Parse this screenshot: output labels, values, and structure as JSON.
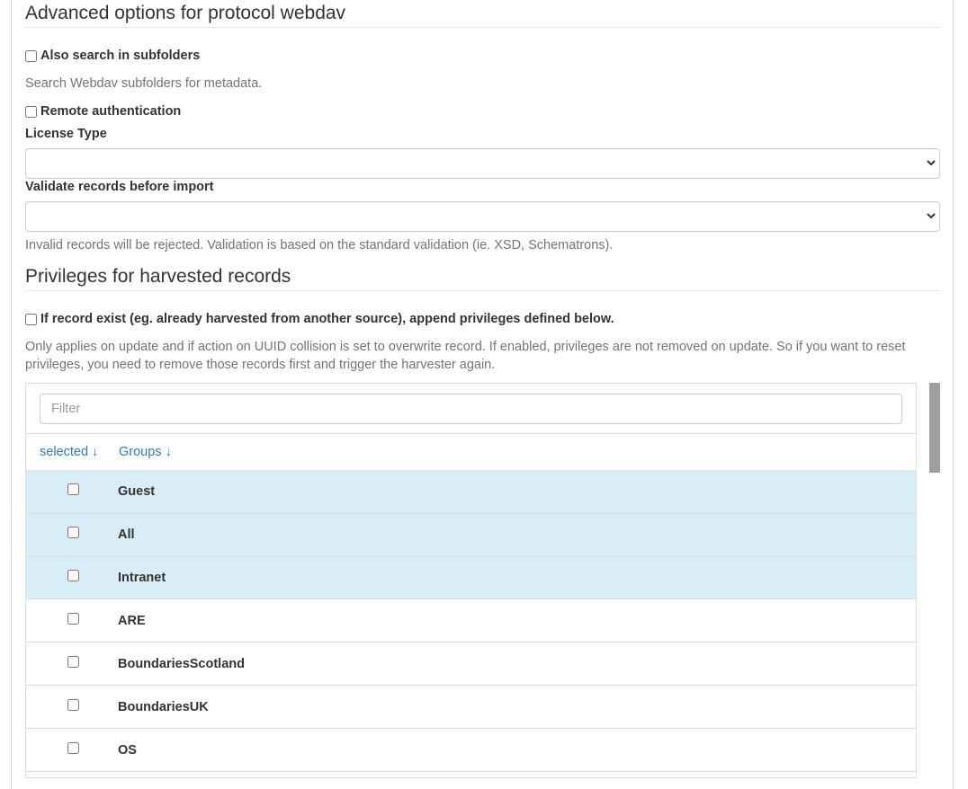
{
  "advanced": {
    "title": "Advanced options for protocol webdav",
    "subfolders_label": "Also search in subfolders",
    "subfolders_help": "Search Webdav subfolders for metadata.",
    "remote_auth_label": "Remote authentication",
    "license_label": "License Type",
    "license_value": "",
    "validate_label": "Validate records before import",
    "validate_value": "",
    "validate_help": "Invalid records will be rejected. Validation is based on the standard validation (ie. XSD, Schematrons)."
  },
  "privileges": {
    "title": "Privileges for harvested records",
    "append_label": "If record exist (eg. already harvested from another source), append privileges defined below.",
    "append_help": "Only applies on update and if action on UUID collision is set to overwrite record. If enabled, privileges are not removed on update. So if you want to reset privileges, you need to remove those records first and trigger the harvester again.",
    "filter_placeholder": "Filter",
    "col_selected": "selected ↓",
    "col_groups": "Groups ↓",
    "rows": [
      {
        "name": "Guest",
        "highlighted": true,
        "checked": false
      },
      {
        "name": "All",
        "highlighted": true,
        "checked": false
      },
      {
        "name": "Intranet",
        "highlighted": true,
        "checked": false
      },
      {
        "name": "ARE",
        "highlighted": false,
        "checked": false
      },
      {
        "name": "BoundariesScotland",
        "highlighted": false,
        "checked": false
      },
      {
        "name": "BoundariesUK",
        "highlighted": false,
        "checked": false
      },
      {
        "name": "OS",
        "highlighted": false,
        "checked": false
      }
    ]
  },
  "colors": {
    "highlight_row": "#d9edf7",
    "link": "#337ab7",
    "help_text": "#737373"
  },
  "icons": {
    "select_caret": "chevron-down-icon"
  }
}
